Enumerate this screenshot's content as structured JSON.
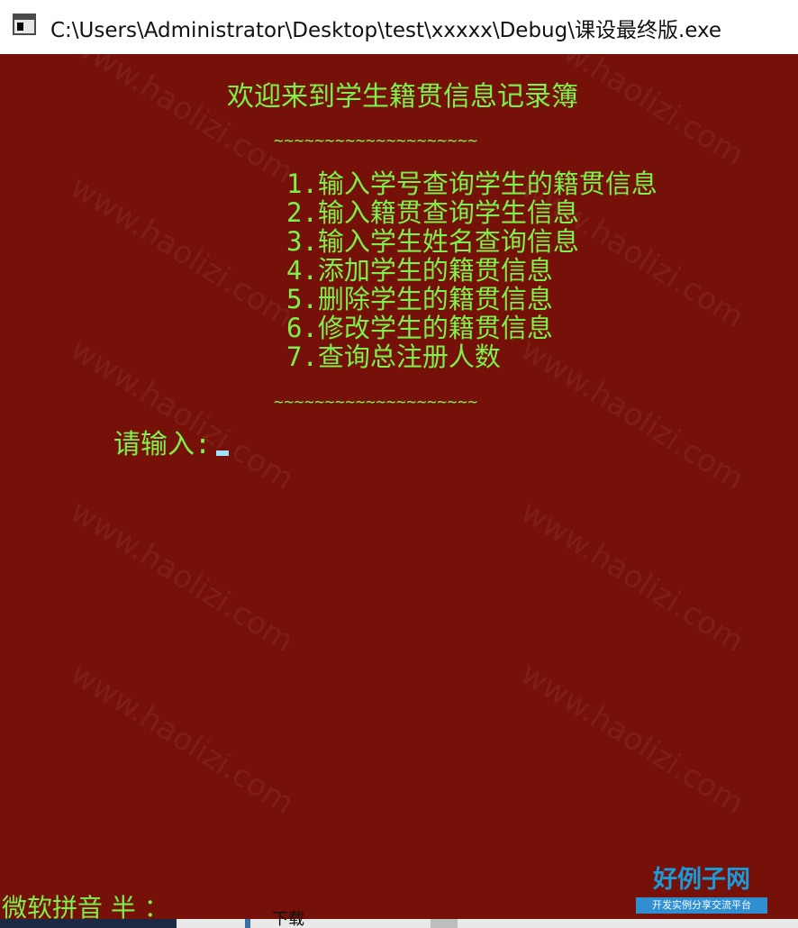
{
  "window": {
    "title": "C:\\Users\\Administrator\\Desktop\\test\\xxxxx\\Debug\\课设最终版.exe"
  },
  "console": {
    "heading": "欢迎来到学生籍贯信息记录簿",
    "separator_top": "~~~~~~~~~~~~~~~~~~~~",
    "menu": [
      "1.输入学号查询学生的籍贯信息",
      "2.输入籍贯查询学生信息",
      "3.输入学生姓名查询信息",
      "4.添加学生的籍贯信息",
      "5.删除学生的籍贯信息",
      "6.修改学生的籍贯信息",
      "7.查询总注册人数"
    ],
    "separator_bottom": "~~~~~~~~~~~~~~~~~~~~",
    "prompt": "请输入:",
    "ime_status": "微软拼音 半 ："
  },
  "watermark": {
    "logo_main": "好例子网",
    "logo_sub": "开发实例分享交流平台"
  },
  "taskbar": {
    "label": "下载"
  },
  "colors": {
    "console_background": "#751109",
    "console_text": "#7ef04a",
    "cursor": "#9fe3ff",
    "titlebar_background": "#ffffff"
  }
}
